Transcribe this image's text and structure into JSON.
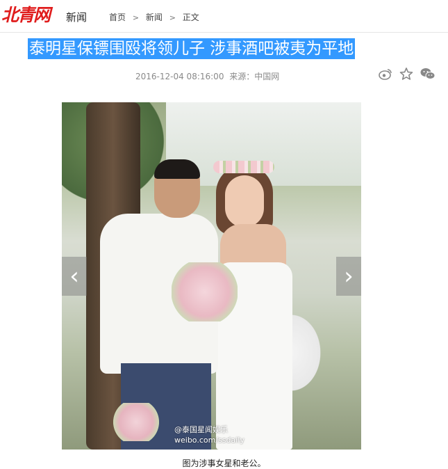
{
  "header": {
    "logo_text": "北青网",
    "channel": "新闻",
    "breadcrumb": [
      "首页",
      "新闻",
      "正文"
    ],
    "separator": ">"
  },
  "article": {
    "title": "泰明星保镖围殴将领儿子 涉事酒吧被夷为平地",
    "datetime": "2016-12-04 08:16:00",
    "source": "来源：中国网",
    "share_icons": [
      "weibo-icon",
      "star-icon",
      "wechat-icon"
    ]
  },
  "gallery": {
    "prev_label": "‹",
    "next_label": "›",
    "watermark_line1": "@泰国星闻娱乐",
    "watermark_line2": "weibo.com/ssdaily",
    "caption": "图为涉事女星和老公。"
  },
  "colors": {
    "logo_red": "#e01d1d",
    "title_highlight": "#3399ff"
  }
}
